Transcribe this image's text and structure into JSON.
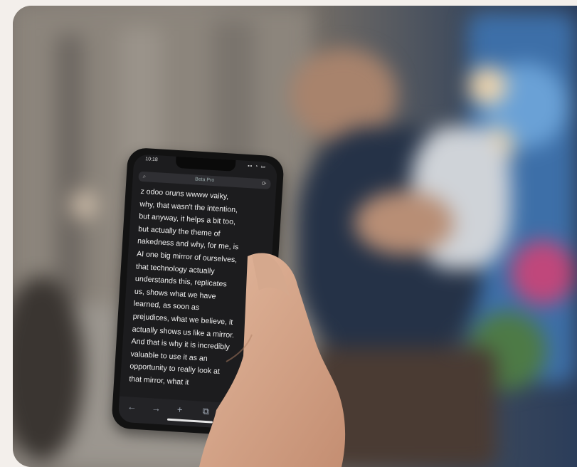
{
  "phone": {
    "status_time": "10:18",
    "status_icons": "▪▪ ◔ ▭",
    "address_title": "Beta Pro",
    "text_lines": [
      "z odoo oruns wwww vaiky,",
      "why, that wasn't the intention,",
      "but anyway, it helps a bit too,",
      "but actually the theme of",
      "nakedness and why, for me, is",
      "AI one big mirror of ourselves,",
      "that technology actually",
      "understands this, replicates",
      "us, shows what we have",
      "learned, as soon as",
      "prejudices, what we believe, it",
      "actually shows us like a mirror.",
      "And that is why it is incredibly",
      "valuable to use it as an",
      "opportunity to really look at",
      "that mirror, what it"
    ],
    "toolbar": {
      "back": "←",
      "forward": "→",
      "add": "+",
      "tabs": "⧉"
    }
  }
}
